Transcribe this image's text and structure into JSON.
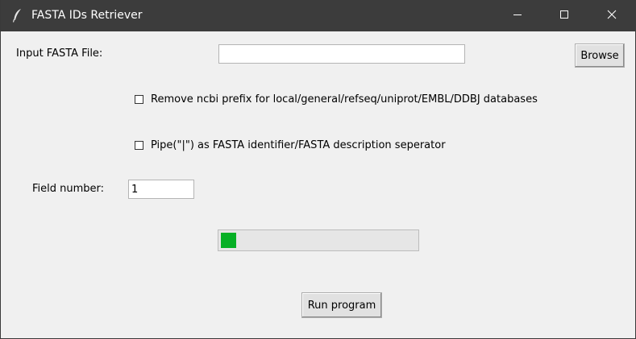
{
  "window": {
    "title": "FASTA IDs Retriever",
    "icon": "feather-icon",
    "controls": [
      "minimize-icon",
      "maximize-icon",
      "close-icon"
    ]
  },
  "form": {
    "input_label": "Input FASTA File:",
    "input_value": "",
    "browse_label": "Browse",
    "option_ncbi_label": "Remove ncbi prefix for local/general/refseq/uniprot/EMBL/DDBJ databases",
    "option_ncbi_checked": false,
    "option_pipe_label": "Pipe(\"|\") as FASTA identifier/FASTA description seperator",
    "option_pipe_checked": false,
    "field_number_label": "Field number:",
    "field_number_value": "1"
  },
  "progress": {
    "fraction": 0.01,
    "fill_color": "#06b025"
  },
  "run_label": "Run program"
}
